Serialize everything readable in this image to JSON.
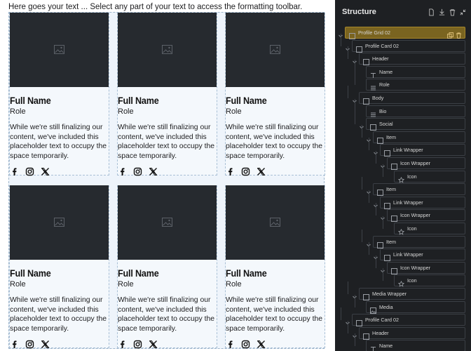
{
  "canvas": {
    "intro_text": "Here goes your text ... Select any part of your text to access the formatting toolbar.",
    "cards": [
      {
        "name": "Full Name",
        "role": "Role",
        "bio": "While we're still finalizing our content, we've included this placeholder text to occupy the space temporarily."
      },
      {
        "name": "Full Name",
        "role": "Role",
        "bio": "While we're still finalizing our content, we've included this placeholder text to occupy the space temporarily."
      },
      {
        "name": "Full Name",
        "role": "Role",
        "bio": "While we're still finalizing our content, we've included this placeholder text to occupy the space temporarily."
      },
      {
        "name": "Full Name",
        "role": "Role",
        "bio": "While we're still finalizing our content, we've included this placeholder text to occupy the space temporarily."
      },
      {
        "name": "Full Name",
        "role": "Role",
        "bio": "While we're still finalizing our content, we've included this placeholder text to occupy the space temporarily."
      },
      {
        "name": "Full Name",
        "role": "Role",
        "bio": "While we're still finalizing our content, we've included this placeholder text to occupy the space temporarily."
      }
    ],
    "social_icons": [
      "facebook-icon",
      "instagram-icon",
      "x-icon"
    ]
  },
  "structure": {
    "title": "Structure",
    "header_icons": [
      "file-icon",
      "download-icon",
      "trash-icon",
      "collapse-icon"
    ],
    "tree": [
      {
        "label": "Profile Grid 02",
        "depth": 0,
        "icon": "box-icon",
        "selected": true
      },
      {
        "label": "Profile Card 02",
        "depth": 1,
        "icon": "box-icon"
      },
      {
        "label": "Header",
        "depth": 2,
        "icon": "box-icon"
      },
      {
        "label": "Name",
        "depth": 3,
        "icon": "text-icon"
      },
      {
        "label": "Role",
        "depth": 3,
        "icon": "lines-icon"
      },
      {
        "label": "Body",
        "depth": 2,
        "icon": "box-icon"
      },
      {
        "label": "Bio",
        "depth": 3,
        "icon": "lines-icon"
      },
      {
        "label": "Social",
        "depth": 3,
        "icon": "box-icon"
      },
      {
        "label": "Item",
        "depth": 4,
        "icon": "box-icon"
      },
      {
        "label": "Link Wrapper",
        "depth": 5,
        "icon": "box-icon"
      },
      {
        "label": "Icon Wrapper",
        "depth": 6,
        "icon": "box-icon"
      },
      {
        "label": "Icon",
        "depth": 7,
        "icon": "star-icon"
      },
      {
        "label": "Item",
        "depth": 4,
        "icon": "box-icon"
      },
      {
        "label": "Link Wrapper",
        "depth": 5,
        "icon": "box-icon"
      },
      {
        "label": "Icon Wrapper",
        "depth": 6,
        "icon": "box-icon"
      },
      {
        "label": "Icon",
        "depth": 7,
        "icon": "star-icon"
      },
      {
        "label": "Item",
        "depth": 4,
        "icon": "box-icon"
      },
      {
        "label": "Link Wrapper",
        "depth": 5,
        "icon": "box-icon"
      },
      {
        "label": "Icon Wrapper",
        "depth": 6,
        "icon": "box-icon"
      },
      {
        "label": "Icon",
        "depth": 7,
        "icon": "star-icon"
      },
      {
        "label": "Media Wrapper",
        "depth": 2,
        "icon": "box-icon"
      },
      {
        "label": "Media",
        "depth": 3,
        "icon": "image-icon"
      },
      {
        "label": "Profile Card 02",
        "depth": 1,
        "icon": "box-icon"
      },
      {
        "label": "Header",
        "depth": 2,
        "icon": "box-icon"
      },
      {
        "label": "Name",
        "depth": 3,
        "icon": "text-icon"
      }
    ]
  },
  "colors": {
    "accent_selected": "#7a6420",
    "panel_bg": "#1e2023",
    "media_bg": "#262a2f"
  }
}
